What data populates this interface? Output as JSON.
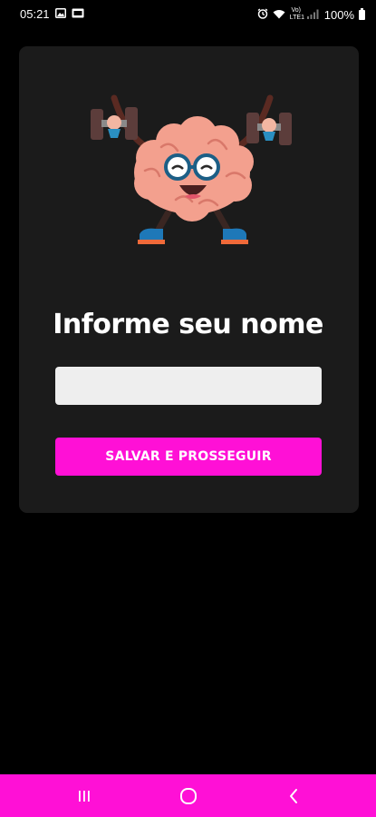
{
  "status_bar": {
    "time": "05:21",
    "volte_text": "Vo) LTE1",
    "battery_percent": "100%",
    "notification_icons": [
      "image-icon",
      "sim-icon"
    ],
    "system_icons": [
      "alarm-icon",
      "wifi-icon",
      "signal-icon",
      "battery-icon"
    ]
  },
  "card": {
    "mascot": "brain-lifting-dumbbells-illustration",
    "title": "Informe seu nome",
    "name_input": {
      "value": "",
      "placeholder": ""
    },
    "save_button_label": "SALVAR E PROSSEGUIR"
  },
  "nav_bar": {
    "buttons": [
      "recent-apps-icon",
      "home-icon",
      "back-icon"
    ]
  },
  "colors": {
    "background": "#000000",
    "card": "#1b1b1b",
    "accent": "#ff10d6",
    "input": "#eeeeee",
    "text": "#ffffff"
  }
}
